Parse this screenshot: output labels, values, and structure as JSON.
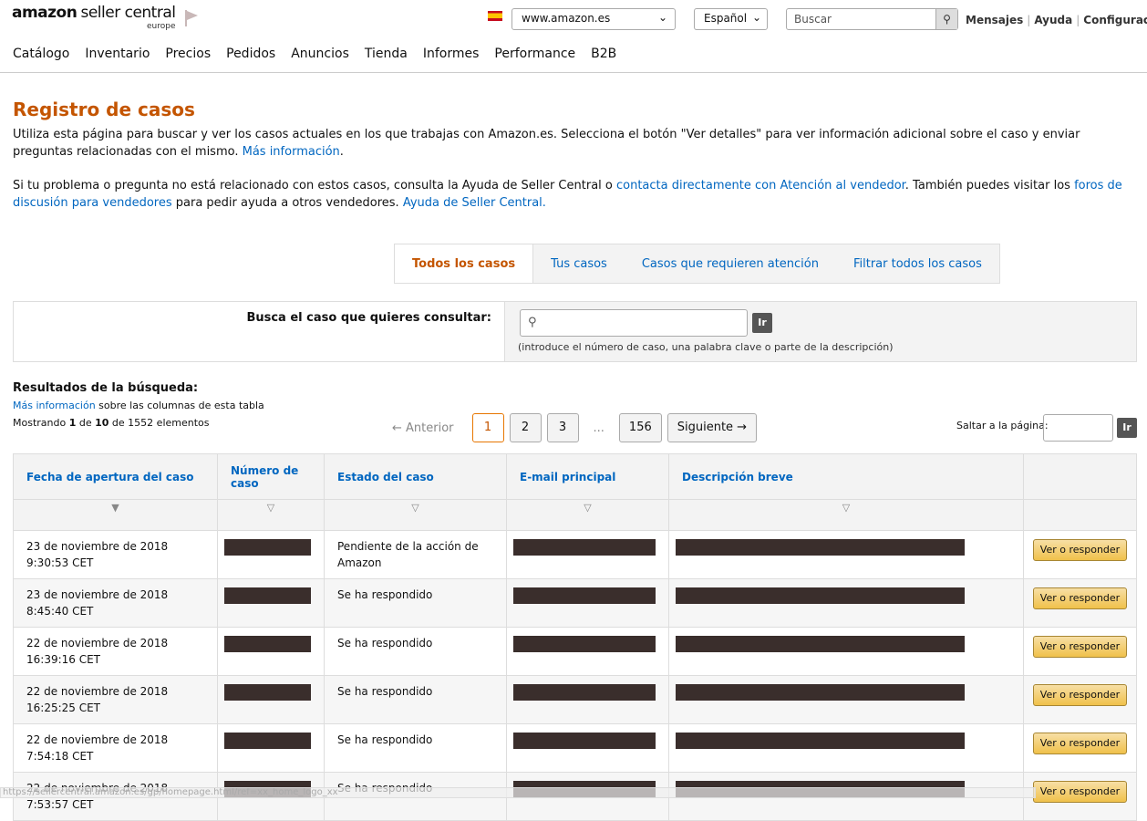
{
  "header": {
    "logo_text": "amazon seller central",
    "logo_sub": "europe",
    "marketplace": "www.amazon.es",
    "language": "Español",
    "search_placeholder": "Buscar",
    "links": [
      "Mensajes",
      "Ayuda",
      "Configuración"
    ]
  },
  "nav": [
    "Catálogo",
    "Inventario",
    "Precios",
    "Pedidos",
    "Anuncios",
    "Tienda",
    "Informes",
    "Performance",
    "B2B"
  ],
  "page": {
    "title": "Registro de casos",
    "p1": "Utiliza esta página para buscar y ver los casos actuales en los que trabajas con Amazon.es. Selecciona el botón \"Ver detalles\" para ver información adicional sobre el caso y enviar preguntas relacionadas con el mismo. ",
    "p1_link": "Más información",
    "p2a": "Si tu problema o pregunta no está relacionado con estos casos, consulta la Ayuda de Seller Central o ",
    "p2_link1": "contacta directamente con Atención al vendedor",
    "p2b": ". También puedes visitar los ",
    "p2_link2": "foros de discusión para vendedores",
    "p2c": " para pedir ayuda a otros vendedores. ",
    "p2_link3": "Ayuda de Seller Central."
  },
  "tabs": [
    "Todos los casos",
    "Tus casos",
    "Casos que requieren atención",
    "Filtrar todos los casos"
  ],
  "search": {
    "label": "Busca el caso que quieres consultar:",
    "go": "Ir",
    "hint": "(introduce el número de caso, una palabra clave o parte de la descripción)"
  },
  "results": {
    "title": "Resultados de la búsqueda:",
    "info_link": "Más información",
    "info_rest": " sobre las columnas de esta tabla",
    "showing_a": "Mostrando ",
    "from": "1",
    "showing_b": " de ",
    "to": "10",
    "showing_c": " de 1552 elementos"
  },
  "pager": {
    "prev": "← Anterior",
    "pages": [
      "1",
      "2",
      "3"
    ],
    "ellipsis": "...",
    "last": "156",
    "next": "Siguiente →",
    "jump_label": "Saltar a la página:",
    "go": "Ir"
  },
  "table": {
    "headers": [
      "Fecha de apertura del caso",
      "Número de caso",
      "Estado del caso",
      "E-mail principal",
      "Descripción breve"
    ],
    "button": "Ver o responder",
    "rows": [
      {
        "date": "23 de noviembre de 2018 9:30:53 CET",
        "status": "Pendiente de la acción de Amazon"
      },
      {
        "date": "23 de noviembre de 2018 8:45:40 CET",
        "status": "Se ha respondido"
      },
      {
        "date": "22 de noviembre de 2018 16:39:16 CET",
        "status": "Se ha respondido"
      },
      {
        "date": "22 de noviembre de 2018 16:25:25 CET",
        "status": "Se ha respondido"
      },
      {
        "date": "22 de noviembre de 2018 7:54:18 CET",
        "status": "Se ha respondido"
      },
      {
        "date": "22 de noviembre de 2018 7:53:57 CET",
        "status": "Se ha respondido"
      }
    ]
  },
  "statusbar": "https://sellercentral.amazon.es/gp/homepage.html/ref=xx_home_logo_xx"
}
